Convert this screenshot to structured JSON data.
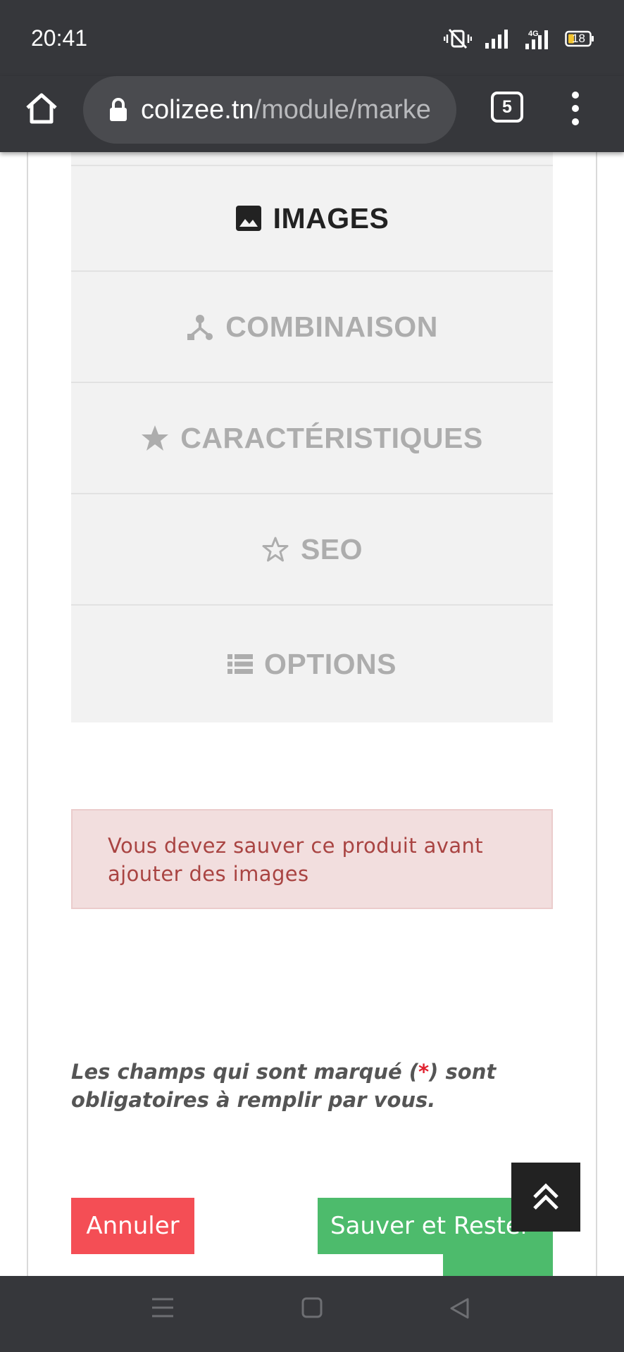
{
  "status_bar": {
    "time": "20:41",
    "network": "4G",
    "battery": "18"
  },
  "browser": {
    "url_host": "colizee.tn",
    "url_path": "/module/marke",
    "tab_count": "5"
  },
  "tabs": [
    {
      "label": "IMAGES",
      "icon": "image-icon",
      "active": true
    },
    {
      "label": "COMBINAISON",
      "icon": "combination-icon",
      "active": false
    },
    {
      "label": "CARACTÉRISTIQUES",
      "icon": "star-filled-icon",
      "active": false
    },
    {
      "label": "SEO",
      "icon": "star-outline-icon",
      "active": false
    },
    {
      "label": "OPTIONS",
      "icon": "list-icon",
      "active": false
    }
  ],
  "alert": {
    "text": "Vous devez sauver ce produit avant ajouter des images"
  },
  "required_note": {
    "before": "Les champs qui sont marqué (",
    "star": "*",
    "after": ") sont obligatoires à remplir par vous."
  },
  "buttons": {
    "cancel": "Annuler",
    "save_stay": "Sauver et Rester"
  },
  "colors": {
    "chrome": "#36373b",
    "tab_bg": "#f2f2f2",
    "alert_bg": "#f2dede",
    "alert_text": "#a94442",
    "cancel": "#f44e55",
    "save": "#4dbb6c"
  }
}
